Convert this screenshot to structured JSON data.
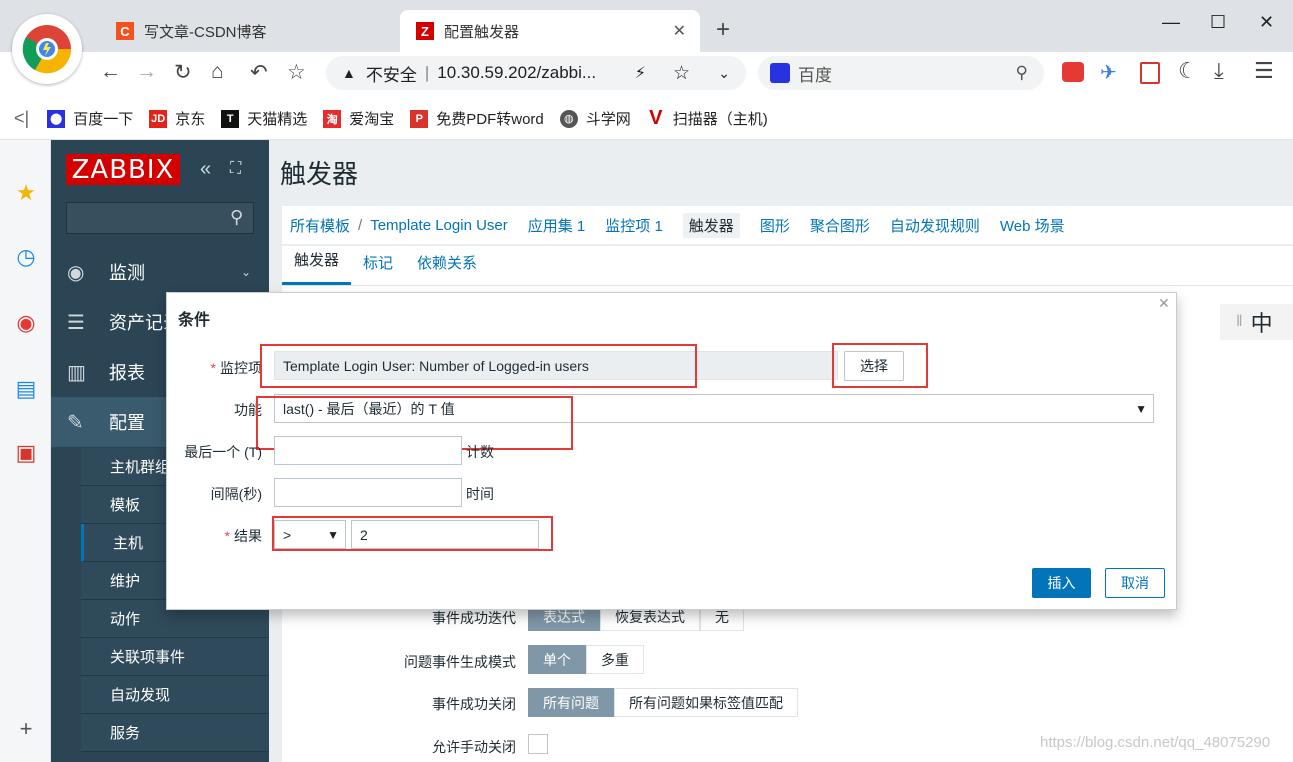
{
  "browser": {
    "tabs": [
      {
        "label": "写文章-CSDN博客",
        "favicon": "C",
        "color": "#f4511e"
      },
      {
        "label": "配置触发器",
        "favicon": "Z",
        "color": "#d40000"
      }
    ],
    "new_tab": "+",
    "window_controls": {
      "minimize": "—",
      "maximize": "☐",
      "close": "✕"
    },
    "address": {
      "security": "不安全",
      "url": "10.30.59.202/zabbi..."
    },
    "search_placeholder": "百度",
    "bookmarks": [
      {
        "label": "百度一下",
        "icon": "baidu-icon",
        "color": "#2932e1"
      },
      {
        "label": "京东",
        "icon": "jd-icon",
        "color": "#e1251b"
      },
      {
        "label": "天猫精选",
        "icon": "tmall-icon",
        "color": "#111111"
      },
      {
        "label": "爱淘宝",
        "icon": "taobao-icon",
        "color": "#e62c2c"
      },
      {
        "label": "免费PDF转word",
        "icon": "pdf-icon",
        "color": "#d9342b"
      },
      {
        "label": "斗学网",
        "icon": "globe-icon",
        "color": "#555555"
      },
      {
        "label": "扫描器（主机)",
        "icon": "v-icon",
        "color": "#d40000"
      }
    ]
  },
  "zabbix": {
    "logo": "ZABBIX",
    "menu": [
      {
        "label": "监测",
        "icon": "eye-icon"
      },
      {
        "label": "资产记录",
        "icon": "list-icon"
      },
      {
        "label": "报表",
        "icon": "chart-icon"
      },
      {
        "label": "配置",
        "icon": "wrench-icon"
      }
    ],
    "submenu": [
      "主机群组",
      "模板",
      "主机",
      "维护",
      "动作",
      "关联项事件",
      "自动发现",
      "服务"
    ],
    "page_title": "触发器",
    "breadcrumb": [
      {
        "label": "所有模板"
      },
      {
        "label": "/"
      },
      {
        "label": "Template Login User"
      },
      {
        "label": "应用集 1"
      },
      {
        "label": "监控项 1"
      },
      {
        "label": "触发器"
      },
      {
        "label": "图形"
      },
      {
        "label": "聚合图形"
      },
      {
        "label": "自动发现规则"
      },
      {
        "label": "Web 场景"
      }
    ],
    "subtabs": [
      "触发器",
      "标记",
      "依赖关系"
    ],
    "form": {
      "ok_event_generation": {
        "label": "事件成功迭代",
        "options": [
          "表达式",
          "恢复表达式",
          "无"
        ],
        "selected": "表达式"
      },
      "problem_mode": {
        "label": "问题事件生成模式",
        "options": [
          "单个",
          "多重"
        ],
        "selected": "单个"
      },
      "ok_close": {
        "label": "事件成功关闭",
        "options": [
          "所有问题",
          "所有问题如果标签值匹配"
        ],
        "selected": "所有问题"
      },
      "manual_close": {
        "label": "允许手动关闭"
      }
    },
    "ime": "中"
  },
  "dialog": {
    "title": "条件",
    "item_label": "监控项",
    "item_value": "Template Login User: Number of Logged-in users",
    "select_button": "选择",
    "function_label": "功能",
    "function_value": "last() - 最后（最近）的 T 值",
    "last_label": "最后一个 (T)",
    "last_suffix": "计数",
    "interval_label": "间隔(秒)",
    "interval_suffix": "时间",
    "result_label": "结果",
    "result_operator": ">",
    "result_value": "2",
    "insert_button": "插入",
    "cancel_button": "取消",
    "required_mark": "*"
  },
  "watermark": "https://blog.csdn.net/qq_48075290"
}
